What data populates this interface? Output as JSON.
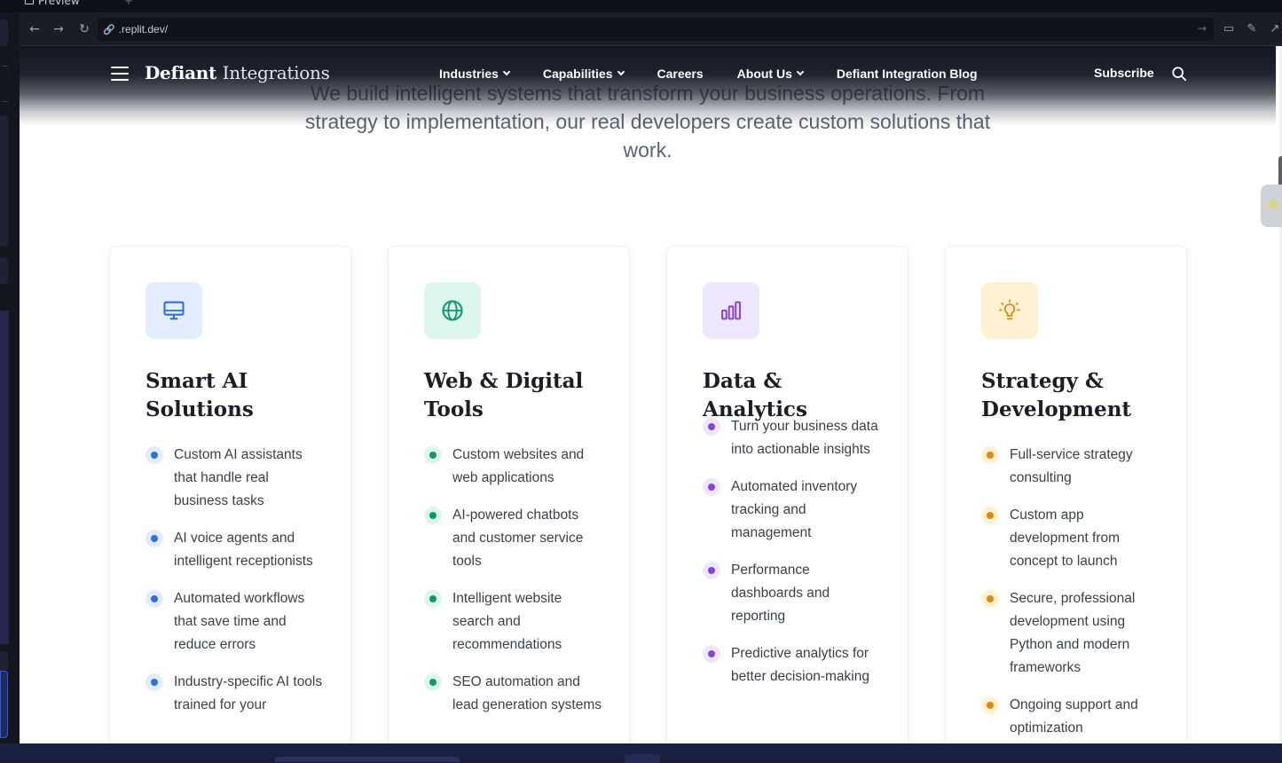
{
  "ide": {
    "tab_label": "Preview",
    "url": ".replit.dev/",
    "nav_icons": [
      "back-arrow-icon",
      "forward-arrow-icon",
      "reload-icon"
    ],
    "tool_icons": [
      "devices-icon",
      "wrench-icon",
      "external-link-icon"
    ]
  },
  "site": {
    "brand_primary": "Defiant",
    "brand_secondary": "Integrations",
    "nav": [
      {
        "label": "Industries",
        "dropdown": true
      },
      {
        "label": "Capabilities",
        "dropdown": true
      },
      {
        "label": "Careers",
        "dropdown": false
      },
      {
        "label": "About Us",
        "dropdown": true
      },
      {
        "label": "Defiant Integration Blog",
        "dropdown": false
      }
    ],
    "subscribe": "Subscribe",
    "hero_subtitle": "We build intelligent systems that transform your business operations. From strategy to implementation, our real developers create custom solutions that work."
  },
  "cards": [
    {
      "title": "Smart AI Solutions",
      "icon": "monitor-icon",
      "accent": "#2f6fe4",
      "tile": "#e3edff",
      "items": [
        "Custom AI assistants that handle real business tasks",
        "AI voice agents and intelligent receptionists",
        "Automated workflows that save time and reduce errors",
        "Industry-specific AI tools trained for your"
      ]
    },
    {
      "title": "Web & Digital Tools",
      "icon": "globe-icon",
      "accent": "#0f9a6a",
      "tile": "#ddf7ec",
      "items": [
        "Custom websites and web applications",
        "AI-powered chatbots and customer service tools",
        "Intelligent website search and recommendations",
        "SEO automation and lead generation systems"
      ]
    },
    {
      "title": "Data & Analytics",
      "icon": "bar-chart-icon",
      "accent": "#8a3fe0",
      "tile": "#efe7ff",
      "items": [
        "Turn your business data into actionable insights",
        "Automated inventory tracking and management",
        "Performance dashboards and reporting",
        "Predictive analytics for better decision-making"
      ]
    },
    {
      "title": "Strategy & Development",
      "icon": "lightbulb-icon",
      "accent": "#e08a0b",
      "tile": "#fff1d2",
      "items": [
        "Full-service strategy consulting",
        "Custom app development from concept to launch",
        "Secure, professional development using Python and modern frameworks",
        "Ongoing support and optimization"
      ]
    }
  ]
}
